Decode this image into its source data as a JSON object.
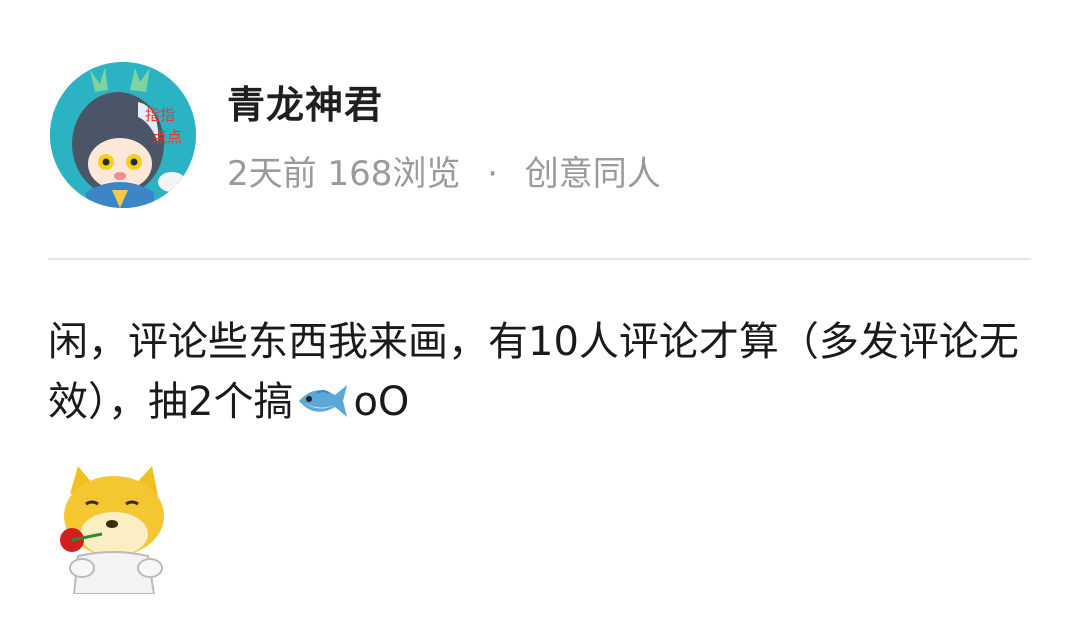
{
  "post": {
    "author": "青龙神君",
    "time": "2天前",
    "views": "168浏览",
    "separator": "·",
    "category": "创意同人",
    "avatar_text": "指指点点",
    "content_text": "闲，评论些东西我来画，有10人评论才算（多发评论无效），抽2个搞",
    "content_emoji": "fish-emoji",
    "content_suffix": "oO",
    "sticker": "doge-with-rose-sticker"
  }
}
